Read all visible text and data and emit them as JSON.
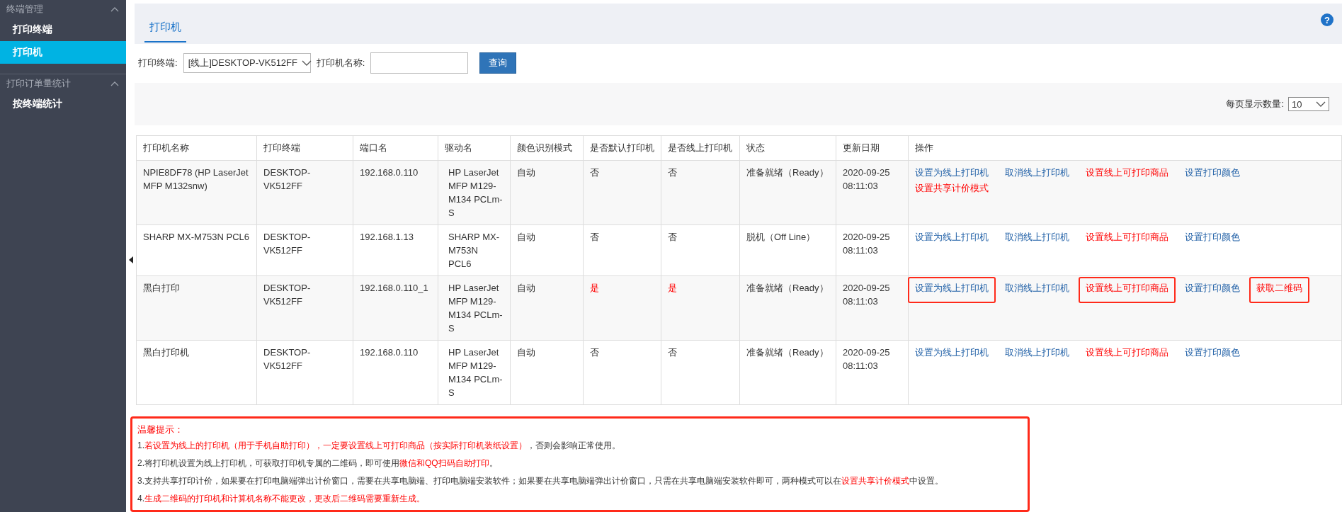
{
  "sidebar": {
    "groups": [
      {
        "title": "终端管理",
        "items": [
          {
            "label": "打印终端",
            "selected": false
          },
          {
            "label": "打印机",
            "selected": true
          }
        ]
      },
      {
        "title": "打印订单量统计",
        "items": [
          {
            "label": "按终端统计",
            "selected": false
          }
        ]
      }
    ]
  },
  "tabs": [
    {
      "label": "打印机",
      "selected": true
    }
  ],
  "help": "?",
  "filters": {
    "terminal_label": "打印终端:",
    "terminal_value": "[线上]DESKTOP-VK512FF",
    "name_label": "打印机名称:",
    "search_button": "查询"
  },
  "page_size": {
    "label": "每页显示数量:",
    "value": "10"
  },
  "table": {
    "columns": [
      "打印机名称",
      "打印终端",
      "端口名",
      "驱动名",
      "颜色识别模式",
      "是否默认打印机",
      "是否线上打印机",
      "状态",
      "更新日期",
      "操作"
    ],
    "rows": [
      {
        "name": "NPIE8DF78 (HP LaserJet MFP M132snw)",
        "terminal": "DESKTOP-VK512FF",
        "port": "192.168.0.110",
        "driver": "HP LaserJet MFP M129-M134 PCLm-S",
        "color_mode": "自动",
        "is_default": {
          "text": "否",
          "red": false
        },
        "is_online": {
          "text": "否",
          "red": false
        },
        "status": "准备就绪（Ready）",
        "updated": "2020-09-25 08:11:03",
        "actions": [
          {
            "label": "设置为线上打印机",
            "red": false,
            "highlighted": false
          },
          {
            "label": "取消线上打印机",
            "red": false,
            "highlighted": false
          },
          {
            "label": "设置线上可打印商品",
            "red": true,
            "highlighted": false
          },
          {
            "label": "设置打印颜色",
            "red": false,
            "highlighted": false
          },
          {
            "label": "设置共享计价模式",
            "red": true,
            "highlighted": false
          }
        ]
      },
      {
        "name": "SHARP MX-M753N PCL6",
        "terminal": "DESKTOP-VK512FF",
        "port": "192.168.1.13",
        "driver": "SHARP MX-M753N PCL6",
        "color_mode": "自动",
        "is_default": {
          "text": "否",
          "red": false
        },
        "is_online": {
          "text": "否",
          "red": false
        },
        "status": "脱机（Off Line）",
        "updated": "2020-09-25 08:11:03",
        "actions": [
          {
            "label": "设置为线上打印机",
            "red": false,
            "highlighted": false
          },
          {
            "label": "取消线上打印机",
            "red": false,
            "highlighted": false
          },
          {
            "label": "设置线上可打印商品",
            "red": true,
            "highlighted": false
          },
          {
            "label": "设置打印颜色",
            "red": false,
            "highlighted": false
          }
        ]
      },
      {
        "name": "黑白打印",
        "terminal": "DESKTOP-VK512FF",
        "port": "192.168.0.110_1",
        "driver": "HP LaserJet MFP M129-M134 PCLm-S",
        "color_mode": "自动",
        "is_default": {
          "text": "是",
          "red": true
        },
        "is_online": {
          "text": "是",
          "red": true
        },
        "status": "准备就绪（Ready）",
        "updated": "2020-09-25 08:11:03",
        "actions": [
          {
            "label": "设置为线上打印机",
            "red": false,
            "highlighted": true
          },
          {
            "label": "取消线上打印机",
            "red": false,
            "highlighted": false
          },
          {
            "label": "设置线上可打印商品",
            "red": true,
            "highlighted": true
          },
          {
            "label": "设置打印颜色",
            "red": false,
            "highlighted": false
          },
          {
            "label": "获取二维码",
            "red": true,
            "highlighted": true
          }
        ]
      },
      {
        "name": "黑白打印机",
        "terminal": "DESKTOP-VK512FF",
        "port": "192.168.0.110",
        "driver": "HP LaserJet MFP M129-M134 PCLm-S",
        "color_mode": "自动",
        "is_default": {
          "text": "否",
          "red": false
        },
        "is_online": {
          "text": "否",
          "red": false
        },
        "status": "准备就绪（Ready）",
        "updated": "2020-09-25 08:11:03",
        "actions": [
          {
            "label": "设置为线上打印机",
            "red": false,
            "highlighted": false
          },
          {
            "label": "取消线上打印机",
            "red": false,
            "highlighted": false
          },
          {
            "label": "设置线上可打印商品",
            "red": true,
            "highlighted": false
          },
          {
            "label": "设置打印颜色",
            "red": false,
            "highlighted": false
          }
        ]
      }
    ]
  },
  "notes": {
    "title": "温馨提示：",
    "items": [
      [
        {
          "text": "1.",
          "red": false
        },
        {
          "text": "若设置为线上的打印机（用于手机自助打印），一定要设置线上可打印商品（按实际打印机装纸设置）",
          "red": true
        },
        {
          "text": "，否则会影响正常使用。",
          "red": false
        }
      ],
      [
        {
          "text": "2.将打印机设置为线上打印机，可获取打印机专属的二维码，即可使用",
          "red": false
        },
        {
          "text": "微信和QQ扫码自助打印",
          "red": true
        },
        {
          "text": "。",
          "red": false
        }
      ],
      [
        {
          "text": "3.支持共享打印计价，如果要在打印电脑端弹出计价窗口，需要在共享电脑端、打印电脑端安装软件；如果要在共享电脑端弹出计价窗口，只需在共享电脑端安装软件即可，两种模式可以在",
          "red": false
        },
        {
          "text": "设置共享计价模式",
          "red": true
        },
        {
          "text": "中设置。",
          "red": false
        }
      ],
      [
        {
          "text": "4.",
          "red": false
        },
        {
          "text": "生成二维码的打印机和计算机名称不能更改，更改后二维码需要重新生成。",
          "red": true
        }
      ]
    ]
  }
}
